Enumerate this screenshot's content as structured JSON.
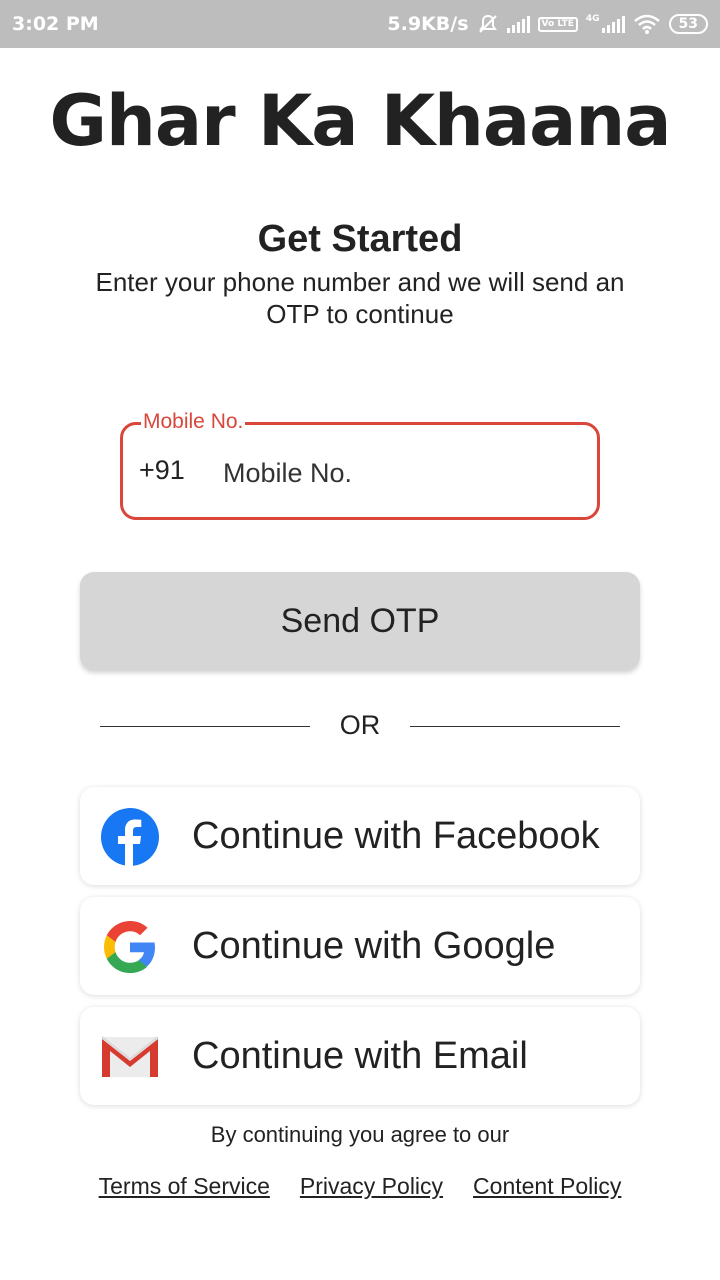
{
  "status_bar": {
    "time": "3:02 PM",
    "net_speed": "5.9KB/s",
    "network_type": "4G",
    "volte": "Vo LTE",
    "battery": "53",
    "icons": [
      "mute-icon",
      "signal-icon",
      "volte-icon",
      "signal-4g-icon",
      "wifi-icon",
      "battery-icon"
    ]
  },
  "app": {
    "title": "Ghar Ka Khaana"
  },
  "intro": {
    "heading": "Get Started",
    "subheading": "Enter your phone number and we will send an OTP to continue"
  },
  "mobile_field": {
    "label": "Mobile No.",
    "prefix": "+91",
    "placeholder": "Mobile No.",
    "value": ""
  },
  "send_otp": {
    "label": "Send OTP"
  },
  "divider": {
    "text": "OR"
  },
  "social": {
    "facebook_label": "Continue with Facebook",
    "google_label": "Continue with Google",
    "email_label": "Continue with Email"
  },
  "legal": {
    "agree_text": "By continuing you agree to our",
    "terms": "Terms of Service",
    "privacy": "Privacy Policy",
    "content": "Content Policy"
  },
  "colors": {
    "accent": "#d9473b",
    "status_bar": "#bdbdbd",
    "button_bg": "#d6d6d6",
    "facebook": "#1877f2"
  }
}
